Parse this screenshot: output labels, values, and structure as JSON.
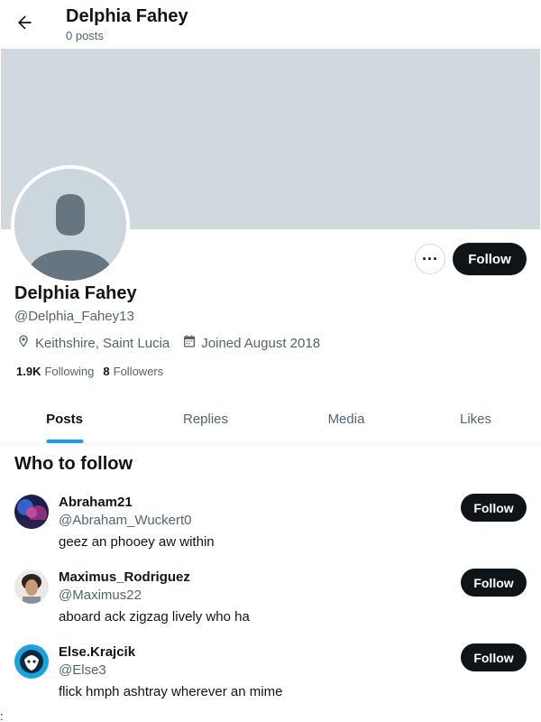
{
  "header": {
    "title": "Delphia Fahey",
    "subtitle": "0 posts"
  },
  "colors": {
    "banner": "#cfd9de",
    "accent": "#1d9bf0",
    "button_dark": "#0f1419",
    "muted_text": "#536471"
  },
  "profile": {
    "name": "Delphia Fahey",
    "handle": "@Delphia_Fahey13",
    "location": "Keithshire, Saint Lucia",
    "joined": "Joined August 2018",
    "following_count": "1.9K",
    "following_label": "Following",
    "followers_count": "8",
    "followers_label": "Followers",
    "more_label": "···",
    "follow_label": "Follow"
  },
  "tabs": [
    {
      "label": "Posts",
      "active": true
    },
    {
      "label": "Replies",
      "active": false
    },
    {
      "label": "Media",
      "active": false
    },
    {
      "label": "Likes",
      "active": false
    }
  ],
  "who_to_follow": {
    "title": "Who to follow",
    "items": [
      {
        "name": "Abraham21",
        "handle": "@Abraham_Wuckert0",
        "bio": "geez an phooey aw within",
        "follow_label": "Follow"
      },
      {
        "name": "Maximus_Rodriguez",
        "handle": "@Maximus22",
        "bio": "aboard ack zigzag lively who ha",
        "follow_label": "Follow"
      },
      {
        "name": "Else.Krajcik",
        "handle": "@Else3",
        "bio": "flick hmph ashtray wherever an mime",
        "follow_label": "Follow"
      }
    ]
  },
  "stray_char": ":"
}
